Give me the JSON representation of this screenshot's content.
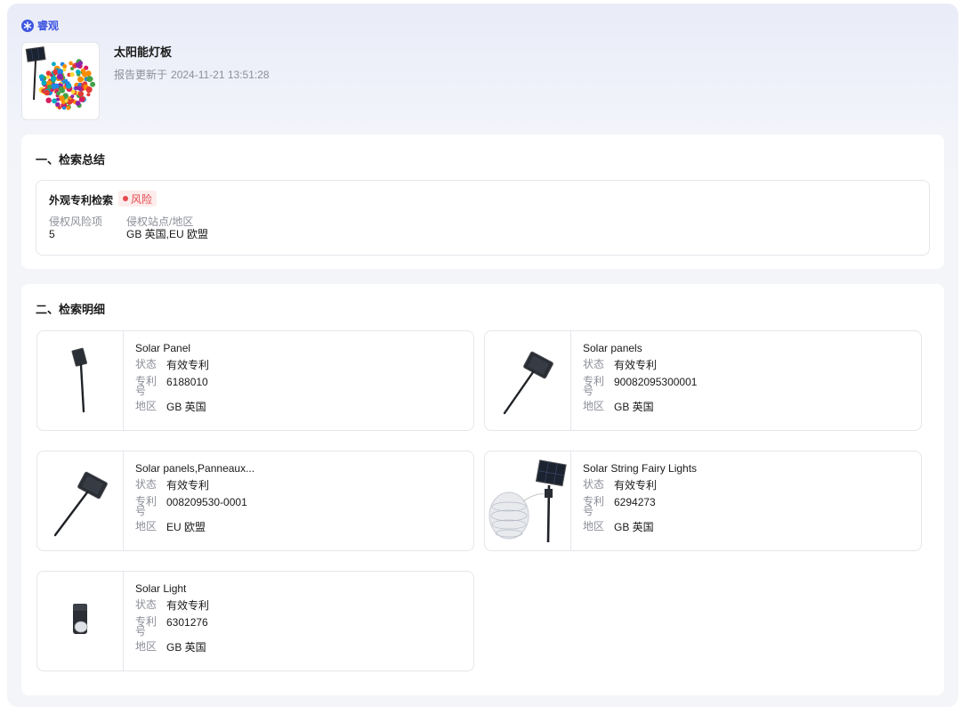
{
  "brand": {
    "name": "睿观"
  },
  "header": {
    "product_title": "太阳能灯板",
    "report_prefix": "报告更新于",
    "report_time": "2024-11-21 13:51:28"
  },
  "summary": {
    "section_title": "一、检索总结",
    "check_label": "外观专利检索",
    "risk_badge": "风险",
    "risk_items_label": "侵权风险项",
    "risk_items_value": "5",
    "sites_label": "侵权站点/地区",
    "sites_value": "GB 英国,EU 欧盟"
  },
  "detail": {
    "section_title": "二、检索明细",
    "labels": {
      "status": "状态",
      "patent_no": "专利号",
      "region": "地区"
    },
    "patents": [
      {
        "title": "Solar Panel",
        "status": "有效专利",
        "patent_no": "6188010",
        "region": "GB 英国"
      },
      {
        "title": "Solar panels",
        "status": "有效专利",
        "patent_no": "90082095300001",
        "region": "GB 英国"
      },
      {
        "title": "Solar panels,Panneaux...",
        "status": "有效专利",
        "patent_no": "008209530-0001",
        "region": "EU 欧盟"
      },
      {
        "title": "Solar String Fairy Lights",
        "status": "有效专利",
        "patent_no": "6294273",
        "region": "GB 英国"
      },
      {
        "title": "Solar Light",
        "status": "有效专利",
        "patent_no": "6301276",
        "region": "GB 英国"
      }
    ]
  },
  "colors": {
    "brand": "#3d55e0",
    "risk": "#e5484d",
    "muted": "#8c8f98"
  }
}
